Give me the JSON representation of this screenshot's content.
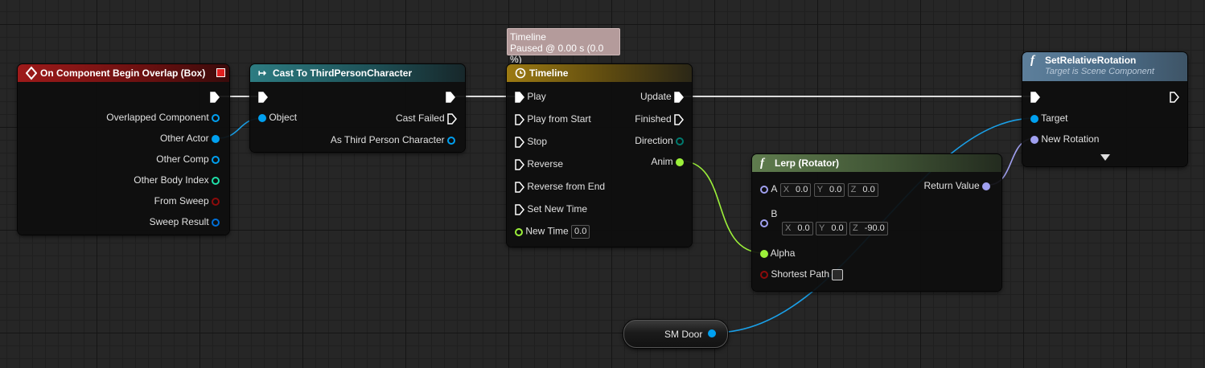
{
  "tooltip": {
    "title": "Timeline",
    "status": "Paused @ 0.00 s (0.0 %)"
  },
  "nodes": {
    "event": {
      "title": "On Component Begin Overlap (Box)",
      "pins": [
        "Overlapped Component",
        "Other Actor",
        "Other Comp",
        "Other Body Index",
        "From Sweep",
        "Sweep Result"
      ]
    },
    "cast": {
      "title": "Cast To ThirdPersonCharacter",
      "object": "Object",
      "cast_failed": "Cast Failed",
      "as_char": "As Third Person Character"
    },
    "timeline": {
      "title": "Timeline",
      "inputs": [
        "Play",
        "Play from Start",
        "Stop",
        "Reverse",
        "Reverse from End",
        "Set New Time"
      ],
      "new_time": "New Time",
      "new_time_value": "0.0",
      "outputs": [
        "Update",
        "Finished",
        "Direction",
        "Anim"
      ]
    },
    "lerp": {
      "title": "Lerp (Rotator)",
      "a": "A",
      "b": "B",
      "x": "X",
      "y": "Y",
      "z": "Z",
      "a_vals": [
        "0.0",
        "0.0",
        "0.0"
      ],
      "b_vals": [
        "0.0",
        "0.0",
        "-90.0"
      ],
      "alpha": "Alpha",
      "shortest_path": "Shortest Path",
      "return_value": "Return Value"
    },
    "setrot": {
      "title": "SetRelativeRotation",
      "subtitle": "Target is Scene Component",
      "target": "Target",
      "new_rotation": "New Rotation"
    },
    "var": {
      "label": "SM Door"
    }
  },
  "colors": {
    "exec": "#ffffff",
    "object": "#00a0f0",
    "int": "#1fe0a9",
    "bool": "#8c0b0b",
    "struct": "#0070d8",
    "float": "#9cf03a",
    "rotator": "#a0a0f0",
    "direction": "#007a6f"
  },
  "icons": {
    "event": "event-diamond-icon",
    "cast": "cast-arrow-icon",
    "timeline": "clock-icon",
    "function": "function-f-icon"
  }
}
